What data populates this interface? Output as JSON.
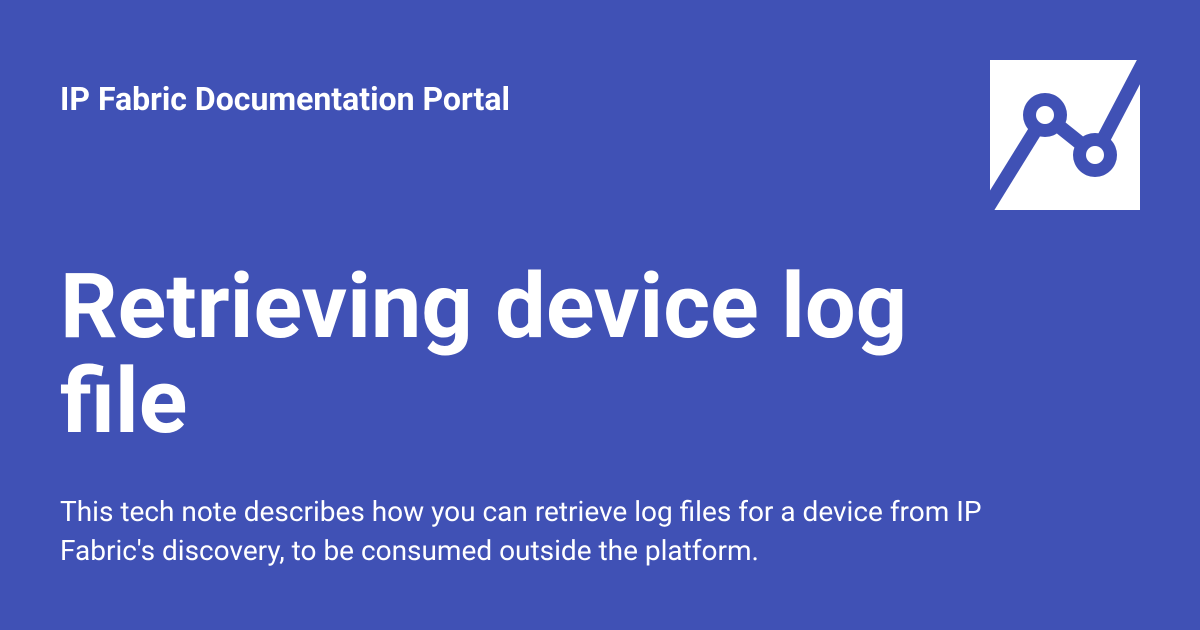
{
  "header": {
    "site_name": "IP Fabric Documentation Portal"
  },
  "main": {
    "title": "Retrieving device log file",
    "description": "This tech note describes how you can retrieve log files for a device from IP Fabric's discovery, to be consumed outside the platform."
  },
  "logo": {
    "name": "ip-fabric-logo",
    "background": "#ffffff",
    "accent": "#4051b5"
  },
  "colors": {
    "background": "#4051b5",
    "text": "#ffffff"
  }
}
